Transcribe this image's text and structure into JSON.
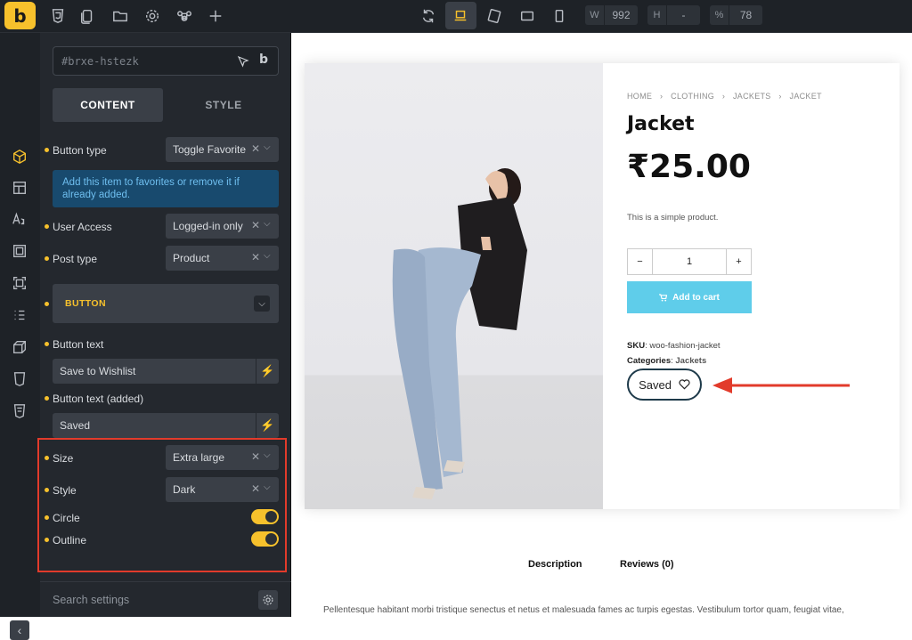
{
  "topbar": {
    "logo": "b",
    "width_label": "W",
    "width_value": "992",
    "height_label": "H",
    "height_value": "-",
    "zoom_label": "%",
    "zoom_value": "78"
  },
  "panel": {
    "selector": "#brxe-hstezk",
    "selector_logo": "b",
    "tabs": [
      "CONTENT",
      "STYLE"
    ],
    "button_type": {
      "label": "Button type",
      "value": "Toggle Favorite"
    },
    "info": "Add this item to favorites or remove it if already added.",
    "user_access": {
      "label": "User Access",
      "value": "Logged-in only"
    },
    "post_type": {
      "label": "Post type",
      "value": "Product"
    },
    "group_title": "BUTTON",
    "button_text": {
      "label": "Button text",
      "value": "Save to Wishlist"
    },
    "button_text_added": {
      "label": "Button text (added)",
      "value": "Saved"
    },
    "size": {
      "label": "Size",
      "value": "Extra large"
    },
    "style": {
      "label": "Style",
      "value": "Dark"
    },
    "circle": {
      "label": "Circle",
      "on": true
    },
    "outline": {
      "label": "Outline",
      "on": true
    },
    "search_placeholder": "Search settings",
    "clear_glyph": "✕",
    "chevron_glyph": "⌵",
    "bolt_glyph": "⚡"
  },
  "product": {
    "breadcrumb": [
      "HOME",
      "CLOTHING",
      "JACKETS",
      "JACKET"
    ],
    "title": "Jacket",
    "price": "₹25.00",
    "description": "This is a simple product.",
    "qty_minus": "−",
    "qty_value": "1",
    "qty_plus": "+",
    "add_to_cart": "Add to cart",
    "sku_label": "SKU",
    "sku_value": "woo-fashion-jacket",
    "categories_label": "Categories",
    "categories_value": "Jackets",
    "saved_label": "Saved",
    "tabs": [
      "Description",
      "Reviews (0)"
    ],
    "body": "Pellentesque habitant morbi tristique senectus et netus et malesuada fames ac turpis egestas. Vestibulum tortor quam, feugiat vitae,"
  },
  "colors": {
    "accent": "#f7c12c",
    "highlight": "#e23b2b",
    "cart_button": "#5fcdea"
  }
}
